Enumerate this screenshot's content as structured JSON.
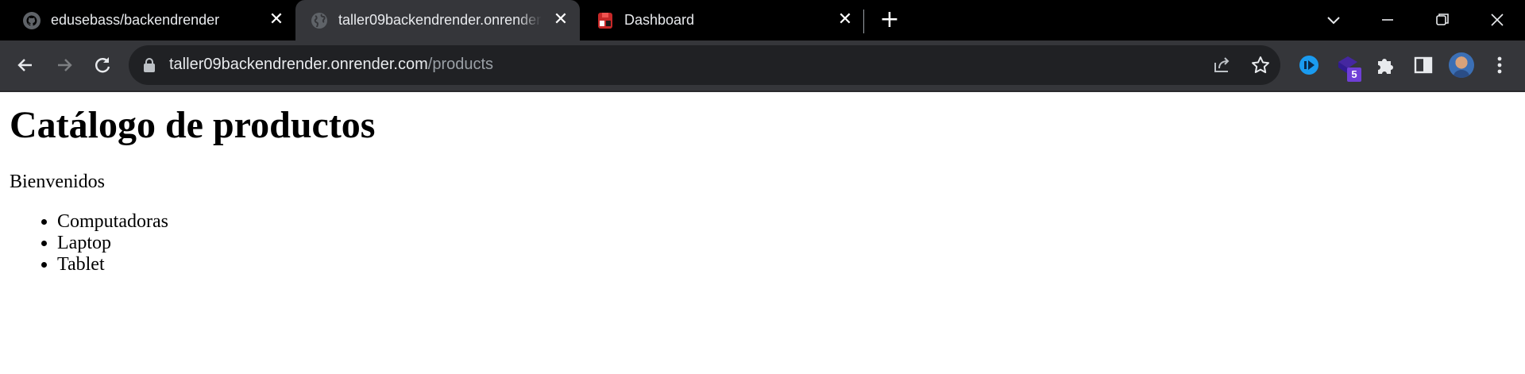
{
  "browser": {
    "tabs": [
      {
        "label": "edusebass/backendrender",
        "favicon": "github-icon",
        "active": false
      },
      {
        "label": "taller09backendrender.onrender.com/products",
        "favicon": "globe-icon",
        "active": true
      },
      {
        "label": "Dashboard",
        "favicon": "render-icon",
        "active": false
      }
    ],
    "address_bar": {
      "host": "taller09backendrender.onrender.com",
      "path": "/products"
    },
    "extension_badge": "5",
    "colors": {
      "tabstrip": "#000000",
      "toolbar": "#35363a",
      "omnibox": "#202124",
      "text": "#e8eaed",
      "badge": "#6f3fd6"
    }
  },
  "page": {
    "title": "Catálogo de productos",
    "welcome": "Bienvenidos",
    "products": [
      "Computadoras",
      "Laptop",
      "Tablet"
    ]
  }
}
